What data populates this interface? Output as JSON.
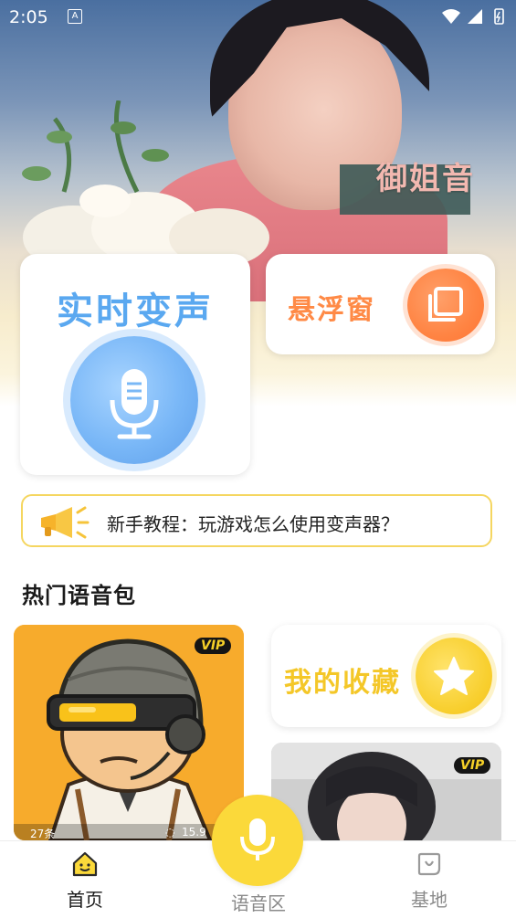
{
  "status_bar": {
    "time": "2:05",
    "a_icon": "A"
  },
  "hero": {
    "tag": "御姐音"
  },
  "cards": {
    "realtime": {
      "title": "实时变声",
      "icon": "microphone-icon"
    },
    "floating": {
      "title": "悬浮窗",
      "icon": "window-stack-icon"
    }
  },
  "tutorial": {
    "text": "新手教程：玩游戏怎么使用变声器？",
    "icon": "megaphone-icon"
  },
  "section": {
    "title": "热门语音包"
  },
  "packs": [
    {
      "badge": "VIP",
      "count": "27条",
      "plays": "15.9"
    },
    {
      "badge": "VIP"
    }
  ],
  "favorites": {
    "title": "我的收藏",
    "icon": "star-icon"
  },
  "nav": {
    "home": "首页",
    "voice": "语音区",
    "base": "基地"
  },
  "colors": {
    "accent_yellow": "#fbd93a",
    "blue": "#5aa8f0",
    "orange": "#ff8a46"
  }
}
